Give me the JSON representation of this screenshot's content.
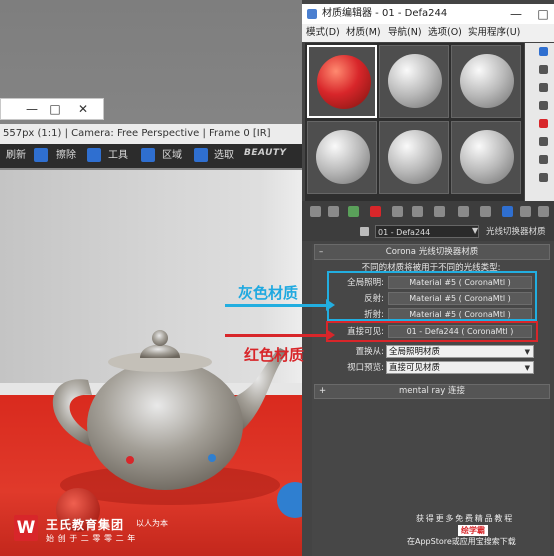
{
  "vfb": {
    "info": "557px (1:1) | Camera: Free Perspective | Frame 0 [IR]",
    "toolbar": {
      "refresh": "刷新",
      "erase": "擦除",
      "tools": "工具",
      "region": "区域",
      "pick": "选取",
      "beauty": "BEAUTY"
    }
  },
  "material_editor": {
    "title": "材质编辑器 - 01 - Defa244",
    "menu": [
      "模式(D)",
      "材质(M)",
      "导航(N)",
      "选项(O)",
      "实用程序(U)"
    ],
    "material_name": "01 - Defa244",
    "material_type": "光线切换器材质",
    "rollout_title": "Corona 光线切换器材质",
    "description": "不同的材质将被用于不同的光线类型:",
    "rows": [
      {
        "label": "全局照明:",
        "value": "Material #5  ( CoronaMtl )"
      },
      {
        "label": "反射:",
        "value": "Material #5  ( CoronaMtl )"
      },
      {
        "label": "折射:",
        "value": "Material #5  ( CoronaMtl )"
      },
      {
        "label": "直接可见:",
        "value": "01 - Defa244  ( CoronaMtl )"
      }
    ],
    "replace_label": "置换从:",
    "replace_value": "全局照明材质",
    "viewport_label": "视口预览:",
    "viewport_value": "直接可见材质",
    "mental_ray": "mental ray 连接"
  },
  "annotations": {
    "gray_material": "灰色材质",
    "red_material": "红色材质"
  },
  "watermark": {
    "logo_letter": "W",
    "company": "王氏教育集团",
    "slogan": "以人为本",
    "founded": "始创于二零零二年",
    "promo1": "获得更多免费精品教程",
    "promo2": "绘学霸",
    "promo3": "在AppStore或应用宝搜索下载"
  },
  "colors": {
    "red_ball": "#d8262a",
    "cyan": "#22aee0",
    "annotation_red": "#d8262a"
  }
}
